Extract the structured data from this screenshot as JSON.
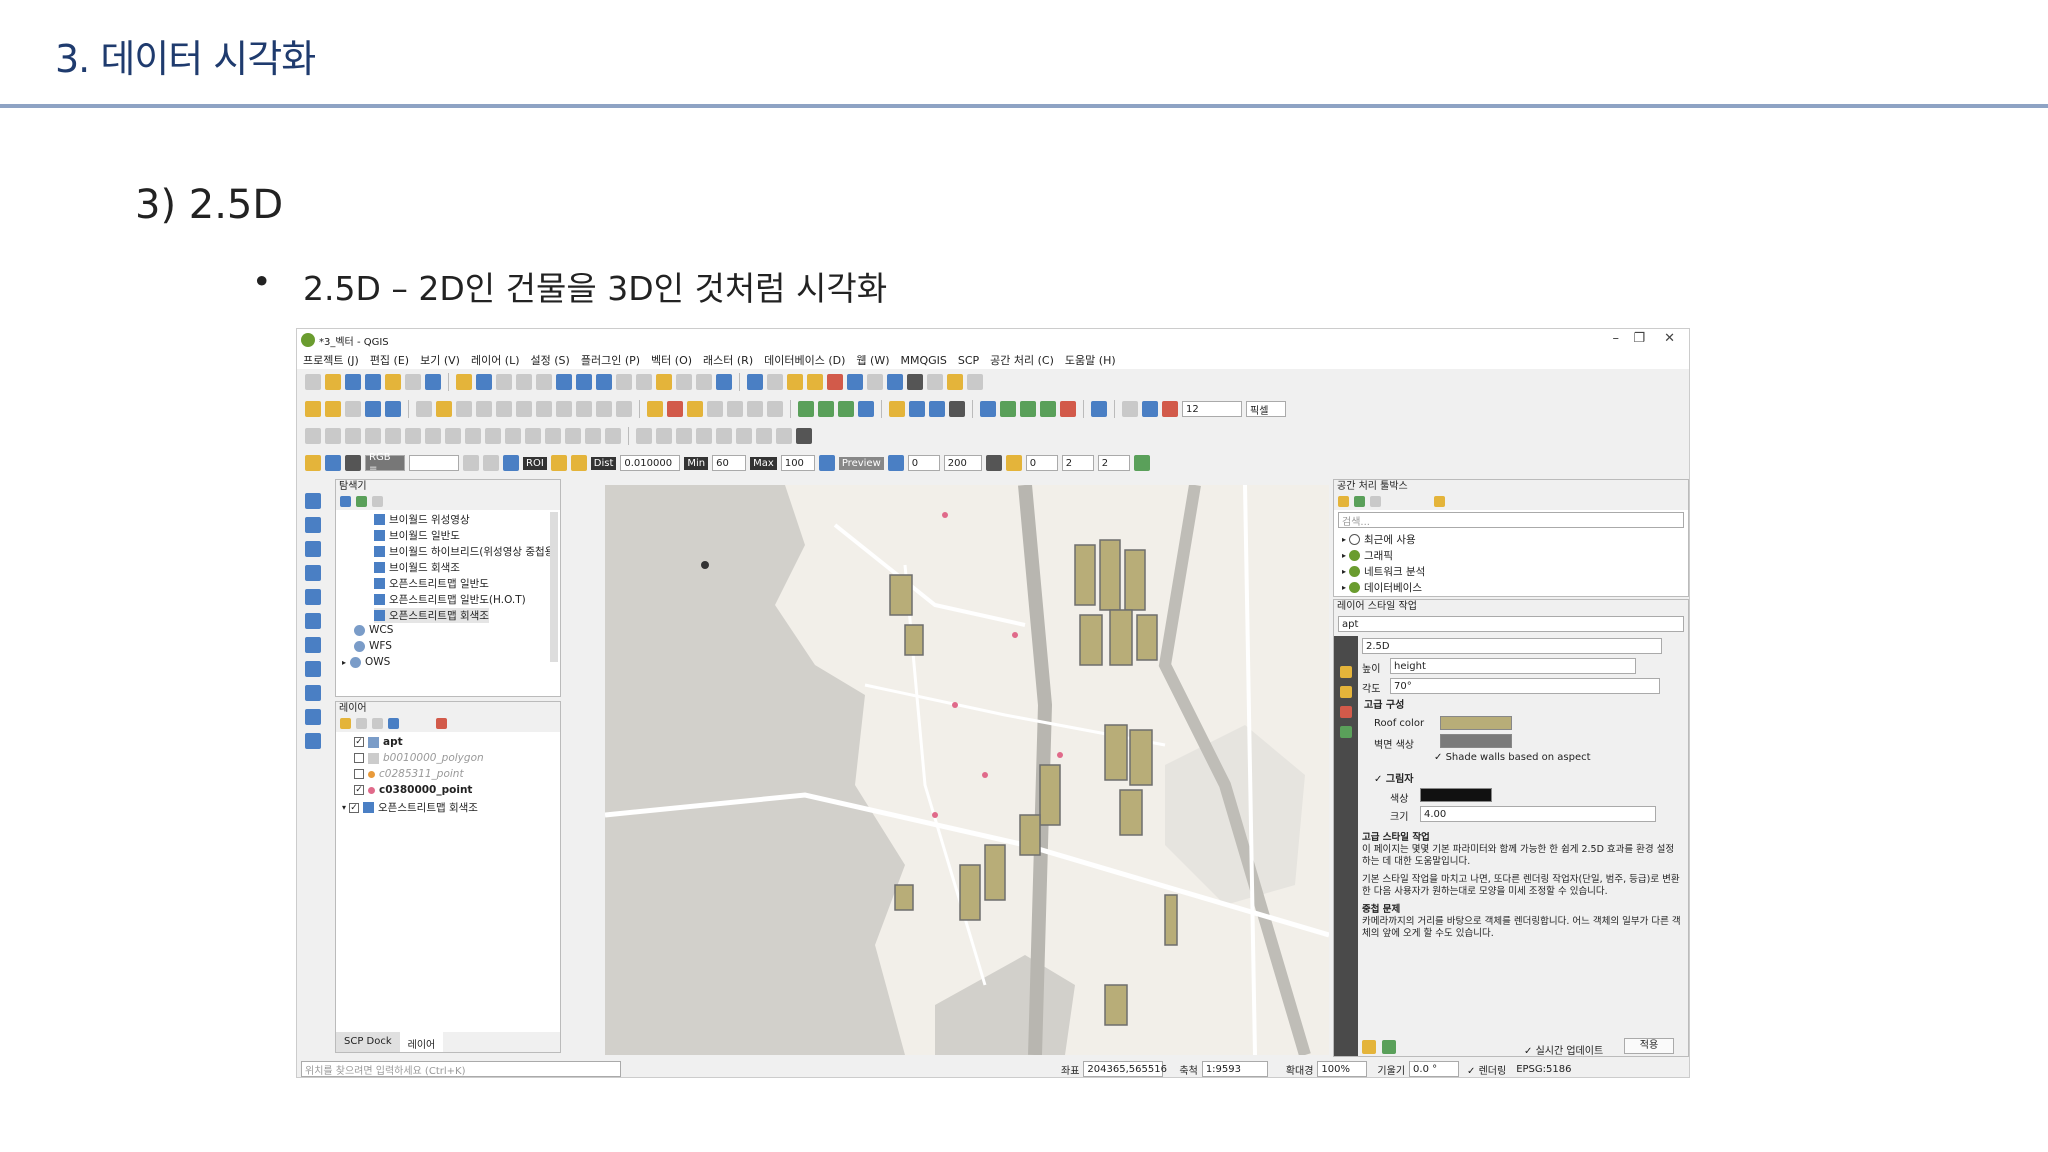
{
  "slide": {
    "title": "3. 데이터 시각화",
    "section": "3) 2.5D",
    "bullet_dot": "•",
    "bullet_text": "2.5D – 2D인 건물을 3D인 것처럼 시각화"
  },
  "qgis": {
    "window_title": "*3_벡터 - QGIS",
    "menu": [
      "프로젝트 (J)",
      "편집 (E)",
      "보기 (V)",
      "레이어 (L)",
      "설정 (S)",
      "플러그인 (P)",
      "벡터 (O)",
      "래스터 (R)",
      "데이터베이스 (D)",
      "웹 (W)",
      "MMQGIS",
      "SCP",
      "공간 처리 (C)",
      "도움말 (H)"
    ],
    "scp_toolbar": {
      "rgb": "RGB =",
      "roi": "ROI",
      "dist_label": "Dist",
      "dist_value": "0.010000",
      "min_label": "Min",
      "min_value": "60",
      "max_label": "Max",
      "max_value": "100",
      "preview": "Preview",
      "t_value": "0",
      "s_value": "200",
      "v1": "0",
      "v2": "2",
      "v3": "2",
      "font_size": "12",
      "unit": "픽셀"
    },
    "browser": {
      "title": "탐색기",
      "items": [
        "브이월드 위성영상",
        "브이월드 일반도",
        "브이월드 하이브리드(위성영상 중첩용)",
        "브이월드 회색조",
        "오픈스트리트맵 일반도",
        "오픈스트리트맵 일반도(H.O.T)",
        "오픈스트리트맵 회색조",
        "WCS",
        "WFS",
        "OWS"
      ]
    },
    "layers": {
      "title": "레이어",
      "items": [
        {
          "name": "apt",
          "checked": "✓"
        },
        {
          "name": "b0010000_polygon",
          "checked": ""
        },
        {
          "name": "c0285311_point",
          "checked": ""
        },
        {
          "name": "c0380000_point",
          "checked": "✓"
        },
        {
          "name": "오픈스트리트맵 회색조",
          "checked": "✓"
        }
      ],
      "tab_scp": "SCP Dock",
      "tab_layers": "레이어"
    },
    "processing": {
      "title": "공간 처리 툴박스",
      "search_placeholder": "검색...",
      "items": [
        "최근에 사용",
        "그래픽",
        "네트워크 분석",
        "데이터베이스"
      ]
    },
    "style": {
      "title": "레이어 스타일 작업",
      "layer": "apt",
      "renderer": "2.5D",
      "height_label": "높이",
      "height_value": "height",
      "angle_label": "각도",
      "angle_value": "70°",
      "advanced": "고급 구성",
      "roof_label": "Roof color",
      "wall_label": "벽면 색상",
      "shade_label": "Shade walls based on aspect",
      "shadow_label": "그림자",
      "shadow_color_label": "색상",
      "shadow_size_label": "크기",
      "shadow_size": "4.00",
      "help_title": "고급 스타일 작업",
      "help_p1": "이 페이지는 몇몇 기본 파라미터와 함께 가능한 한 쉽게 2.5D 효과를 환경 설정하는 데 대한 도움말입니다.",
      "help_p2": "기본 스타일 작업을 마치고 나면, 또다른 렌더링 작업자(단일, 범주, 등급)로 변환한 다음 사용자가 원하는대로 모양을 미세 조정할 수 있습니다.",
      "help_title2": "중첩 문제",
      "help_p3": "카메라까지의 거리를 바탕으로 객체를 렌더링합니다. 어느 객체의 일부가 다른 객체의 앞에 오게 할 수도 있습니다.",
      "live_update": "실시간 업데이트",
      "apply": "적용"
    },
    "status": {
      "locator_placeholder": "위치를 찾으려면 입력하세요 (Ctrl+K)",
      "coord_label": "좌표",
      "coord_value": "204365,565516",
      "scale_label": "축척",
      "scale_value": "1:9593",
      "mag_label": "확대경",
      "mag_value": "100%",
      "rot_label": "기울기",
      "rot_value": "0.0 °",
      "render": "렌더링",
      "crs": "EPSG:5186"
    },
    "colors": {
      "roof": "#b8ad78",
      "wall": "#7a7a7a",
      "shadow": "#111111",
      "accent": "#1f3b6e"
    }
  }
}
